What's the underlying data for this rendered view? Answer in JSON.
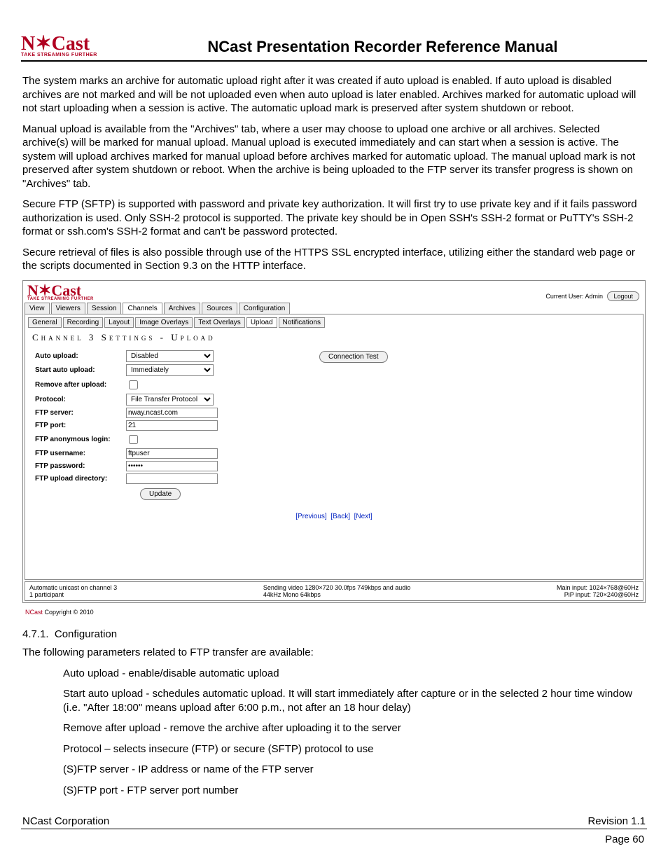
{
  "logo": {
    "main": "N✶Cast",
    "tag": "TAKE STREAMING FURTHER"
  },
  "doc_title": "NCast Presentation Recorder Reference Manual",
  "paragraphs": {
    "p1": "The system marks an archive for automatic upload right after it was created if auto upload is enabled. If auto upload is disabled archives are not marked and will be not uploaded even when auto upload is later enabled. Archives marked for automatic upload will not start uploading when a session is active. The automatic upload mark is preserved after system shutdown or reboot.",
    "p2": "Manual upload is available from the \"Archives\" tab, where a user may choose to upload one archive or all archives. Selected archive(s) will be marked for manual upload. Manual upload is executed immediately and can start when a session is active. The system will upload archives marked for manual upload before archives marked for automatic upload. The manual upload mark is not preserved after system shutdown or reboot. When the archive is being uploaded to the FTP server its transfer progress is shown on \"Archives\" tab.",
    "p3": "Secure FTP (SFTP) is supported with password and private key authorization. It will first try to use private key and if it fails password authorization is used. Only SSH-2 protocol is supported. The private key should be in Open SSH's SSH-2 format or PuTTY's SSH-2 format or ssh.com's SSH-2 format and can't be password protected.",
    "p4": "Secure retrieval of files is also possible through use of the HTTPS SSL encrypted interface, utilizing either the standard web page or the scripts documented in Section 9.3 on the HTTP interface."
  },
  "shot": {
    "user_label": "Current User: Admin",
    "logout": "Logout",
    "tabs": [
      "View",
      "Viewers",
      "Session",
      "Channels",
      "Archives",
      "Sources",
      "Configuration"
    ],
    "active_tab_index": 3,
    "subtabs": [
      "General",
      "Recording",
      "Layout",
      "Image Overlays",
      "Text Overlays",
      "Upload",
      "Notifications"
    ],
    "active_subtab_index": 5,
    "panel_title": "Channel 3 Settings - Upload",
    "conn_test": "Connection Test",
    "form": {
      "auto_upload": {
        "label": "Auto upload:",
        "value": "Disabled"
      },
      "start_auto": {
        "label": "Start auto upload:",
        "value": "Immediately"
      },
      "remove_after": {
        "label": "Remove after upload:"
      },
      "protocol": {
        "label": "Protocol:",
        "value": "File Transfer Protocol"
      },
      "server": {
        "label": "FTP server:",
        "value": "nway.ncast.com"
      },
      "port": {
        "label": "FTP port:",
        "value": "21"
      },
      "anon": {
        "label": "FTP anonymous login:"
      },
      "username": {
        "label": "FTP username:",
        "value": "ftpuser"
      },
      "password": {
        "label": "FTP password:",
        "value": "••••••"
      },
      "updir": {
        "label": "FTP upload directory:",
        "value": ""
      },
      "update": "Update"
    },
    "nav": {
      "prev": "[Previous]",
      "back": "[Back]",
      "next": "[Next]"
    },
    "status": {
      "left1": "Automatic unicast on channel 3",
      "left2": "1 participant",
      "mid1": "Sending video 1280×720 30.0fps 749kbps and audio",
      "mid2": "44kHz Mono 64kbps",
      "right1": "Main input: 1024×768@60Hz",
      "right2": "PiP input: 720×240@60Hz"
    },
    "copyright": " Copyright © 2010"
  },
  "section": {
    "num": "4.7.1.",
    "title": "Configuration",
    "intro": "The following parameters related to FTP transfer are available:",
    "items": [
      "Auto upload - enable/disable automatic upload",
      "Start auto upload - schedules automatic upload. It will start immediately after capture or in the selected 2 hour time window (i.e. \"After 18:00\" means upload after 6:00 p.m., not after an 18 hour delay)",
      "Remove after upload - remove the archive after uploading it to the server",
      "Protocol – selects insecure (FTP) or secure (SFTP) protocol to use",
      "(S)FTP server - IP address or name of the FTP server",
      "(S)FTP port - FTP server port number"
    ]
  },
  "footer": {
    "left": "NCast Corporation",
    "right": "Revision 1.1",
    "page": "Page 60"
  }
}
